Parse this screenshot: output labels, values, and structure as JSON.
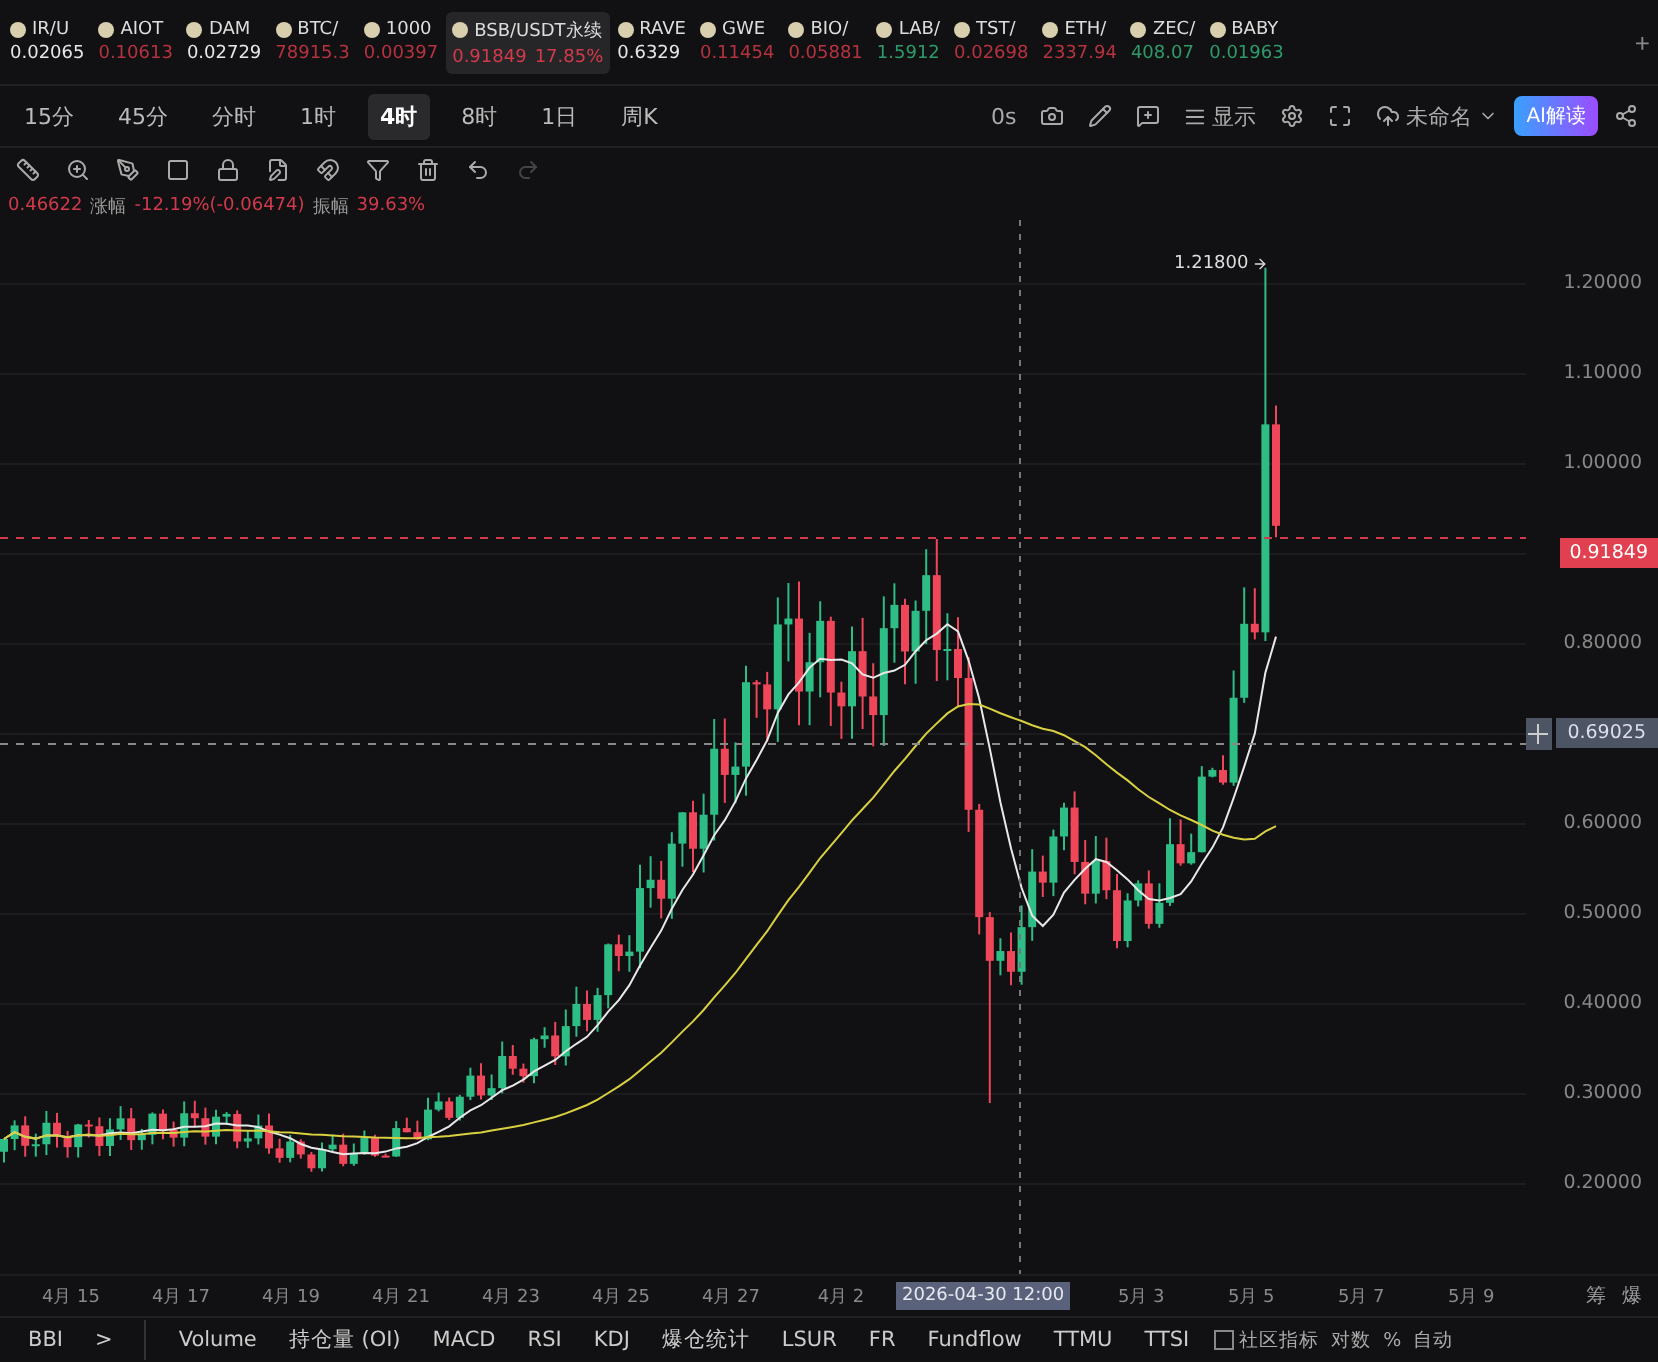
{
  "tickers": [
    {
      "name": "IR/U",
      "price": "0.02065",
      "color": "#e6e6e6",
      "selected": false
    },
    {
      "name": "AIOT",
      "price": "0.10613",
      "color": "#b5323f",
      "selected": false
    },
    {
      "name": "DAM",
      "price": "0.02729",
      "color": "#e6e6e6",
      "selected": false
    },
    {
      "name": "BTC/",
      "price": "78915.3",
      "color": "#b5323f",
      "selected": false
    },
    {
      "name": "1000",
      "price": "0.00397",
      "color": "#b5323f",
      "selected": false
    },
    {
      "name": "BSB/USDT永续",
      "price": "0.91849",
      "change": "17.85%",
      "color": "#d13a4a",
      "selected": true
    },
    {
      "name": "RAVE",
      "price": "0.6329",
      "color": "#e6e6e6",
      "selected": false
    },
    {
      "name": "GWE",
      "price": "0.11454",
      "color": "#b5323f",
      "selected": false
    },
    {
      "name": "BIO/",
      "price": "0.05881",
      "color": "#b5323f",
      "selected": false
    },
    {
      "name": "LAB/",
      "price": "1.5912",
      "color": "#2e9a6a",
      "selected": false
    },
    {
      "name": "TST/",
      "price": "0.02698",
      "color": "#b5323f",
      "selected": false
    },
    {
      "name": "ETH/",
      "price": "2337.94",
      "color": "#b5323f",
      "selected": false
    },
    {
      "name": "ZEC/",
      "price": "408.07",
      "color": "#2e9a6a",
      "selected": false
    },
    {
      "name": "BABY",
      "price": "0.01963",
      "color": "#2e9a6a",
      "selected": false
    }
  ],
  "add_tab": "+",
  "timeframes": [
    {
      "label": "15分",
      "selected": false
    },
    {
      "label": "45分",
      "selected": false
    },
    {
      "label": "分时",
      "selected": false
    },
    {
      "label": "1时",
      "selected": false
    },
    {
      "label": "4时",
      "selected": true
    },
    {
      "label": "8时",
      "selected": false
    },
    {
      "label": "1日",
      "selected": false
    },
    {
      "label": "周K",
      "selected": false
    }
  ],
  "toolbar": {
    "countdown": "0s",
    "display": "显示",
    "layout": "未命名",
    "ai": "AI解读"
  },
  "info": {
    "close": "0.46622",
    "change_label": "涨幅",
    "change": "-12.19%(-0.06474)",
    "amplitude_label": "振幅",
    "amplitude": "39.63%"
  },
  "peak_label": "1.21800",
  "price_axis": [
    {
      "kind": "tick",
      "label": "1.20000"
    },
    {
      "kind": "tick",
      "label": "1.10000"
    },
    {
      "kind": "tick",
      "label": "1.00000"
    },
    {
      "kind": "last",
      "label": "0.91849"
    },
    {
      "kind": "tick",
      "label": "0.80000"
    },
    {
      "kind": "mark",
      "label": "0.69025"
    },
    {
      "kind": "tick",
      "label": "0.60000"
    },
    {
      "kind": "tick",
      "label": "0.50000"
    },
    {
      "kind": "tick",
      "label": "0.40000"
    },
    {
      "kind": "tick",
      "label": "0.30000"
    },
    {
      "kind": "tick",
      "label": "0.20000"
    }
  ],
  "time_axis": [
    {
      "kind": "tick",
      "label": "4月 15"
    },
    {
      "kind": "tick",
      "label": "4月 17"
    },
    {
      "kind": "tick",
      "label": "4月 19"
    },
    {
      "kind": "tick",
      "label": "4月 21"
    },
    {
      "kind": "tick",
      "label": "4月 23"
    },
    {
      "kind": "tick",
      "label": "4月 25"
    },
    {
      "kind": "tick",
      "label": "4月 27"
    },
    {
      "kind": "tick",
      "label": "4月 2"
    },
    {
      "kind": "cursor",
      "label": "2026-04-30 12:00"
    },
    {
      "kind": "tick",
      "label": "5月 3"
    },
    {
      "kind": "tick",
      "label": "5月 5"
    },
    {
      "kind": "tick",
      "label": "5月 7"
    },
    {
      "kind": "tick",
      "label": "5月 9"
    }
  ],
  "axis_buttons": [
    "筹",
    "爆"
  ],
  "bottom": {
    "current": "BBI",
    "more": ">",
    "indicators": [
      "Volume",
      "持仓量 (OI)",
      "MACD",
      "RSI",
      "KDJ",
      "爆仓统计",
      "LSUR",
      "FR",
      "Fundflow",
      "TTMU",
      "TTSI"
    ],
    "community": {
      "label": "社区指标",
      "checked": false
    },
    "options": [
      "对数",
      "%",
      "自动"
    ]
  }
}
